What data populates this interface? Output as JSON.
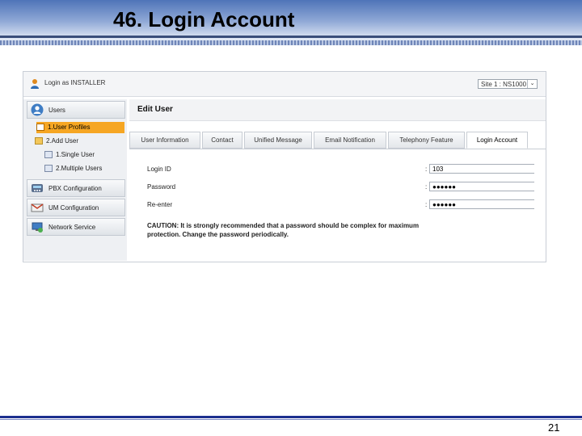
{
  "slide": {
    "title": "46. Login Account",
    "page_number": "21"
  },
  "app": {
    "login_as": "Login as INSTALLER",
    "site_selector": {
      "value": "Site 1 : NS1000",
      "arrow": "⌄"
    },
    "sidebar": {
      "sections": [
        {
          "label": "Users",
          "icon": "users-icon"
        },
        {
          "label": "PBX Configuration",
          "icon": "pbx-icon"
        },
        {
          "label": "UM Configuration",
          "icon": "mail-icon"
        },
        {
          "label": "Network Service",
          "icon": "network-icon"
        }
      ],
      "items": [
        {
          "label": "1.User Profiles"
        },
        {
          "label": "2.Add User"
        },
        {
          "label": "1.Single User"
        },
        {
          "label": "2.Multiple Users"
        }
      ]
    },
    "main": {
      "title": "Edit User",
      "tabs": [
        {
          "label": "User Information"
        },
        {
          "label": "Contact"
        },
        {
          "label": "Unified Message"
        },
        {
          "label": "Email Notification"
        },
        {
          "label": "Telephony Feature"
        },
        {
          "label": "Login Account"
        }
      ],
      "active_tab": "Login Account",
      "fields": [
        {
          "label": "Login ID",
          "value": "103"
        },
        {
          "label": "Password",
          "value": "●●●●●●"
        },
        {
          "label": "Re-enter",
          "value": "●●●●●●"
        }
      ],
      "caution": "CAUTION: It is strongly recommended that a password should be complex for maximum protection. Change the password periodically."
    }
  }
}
